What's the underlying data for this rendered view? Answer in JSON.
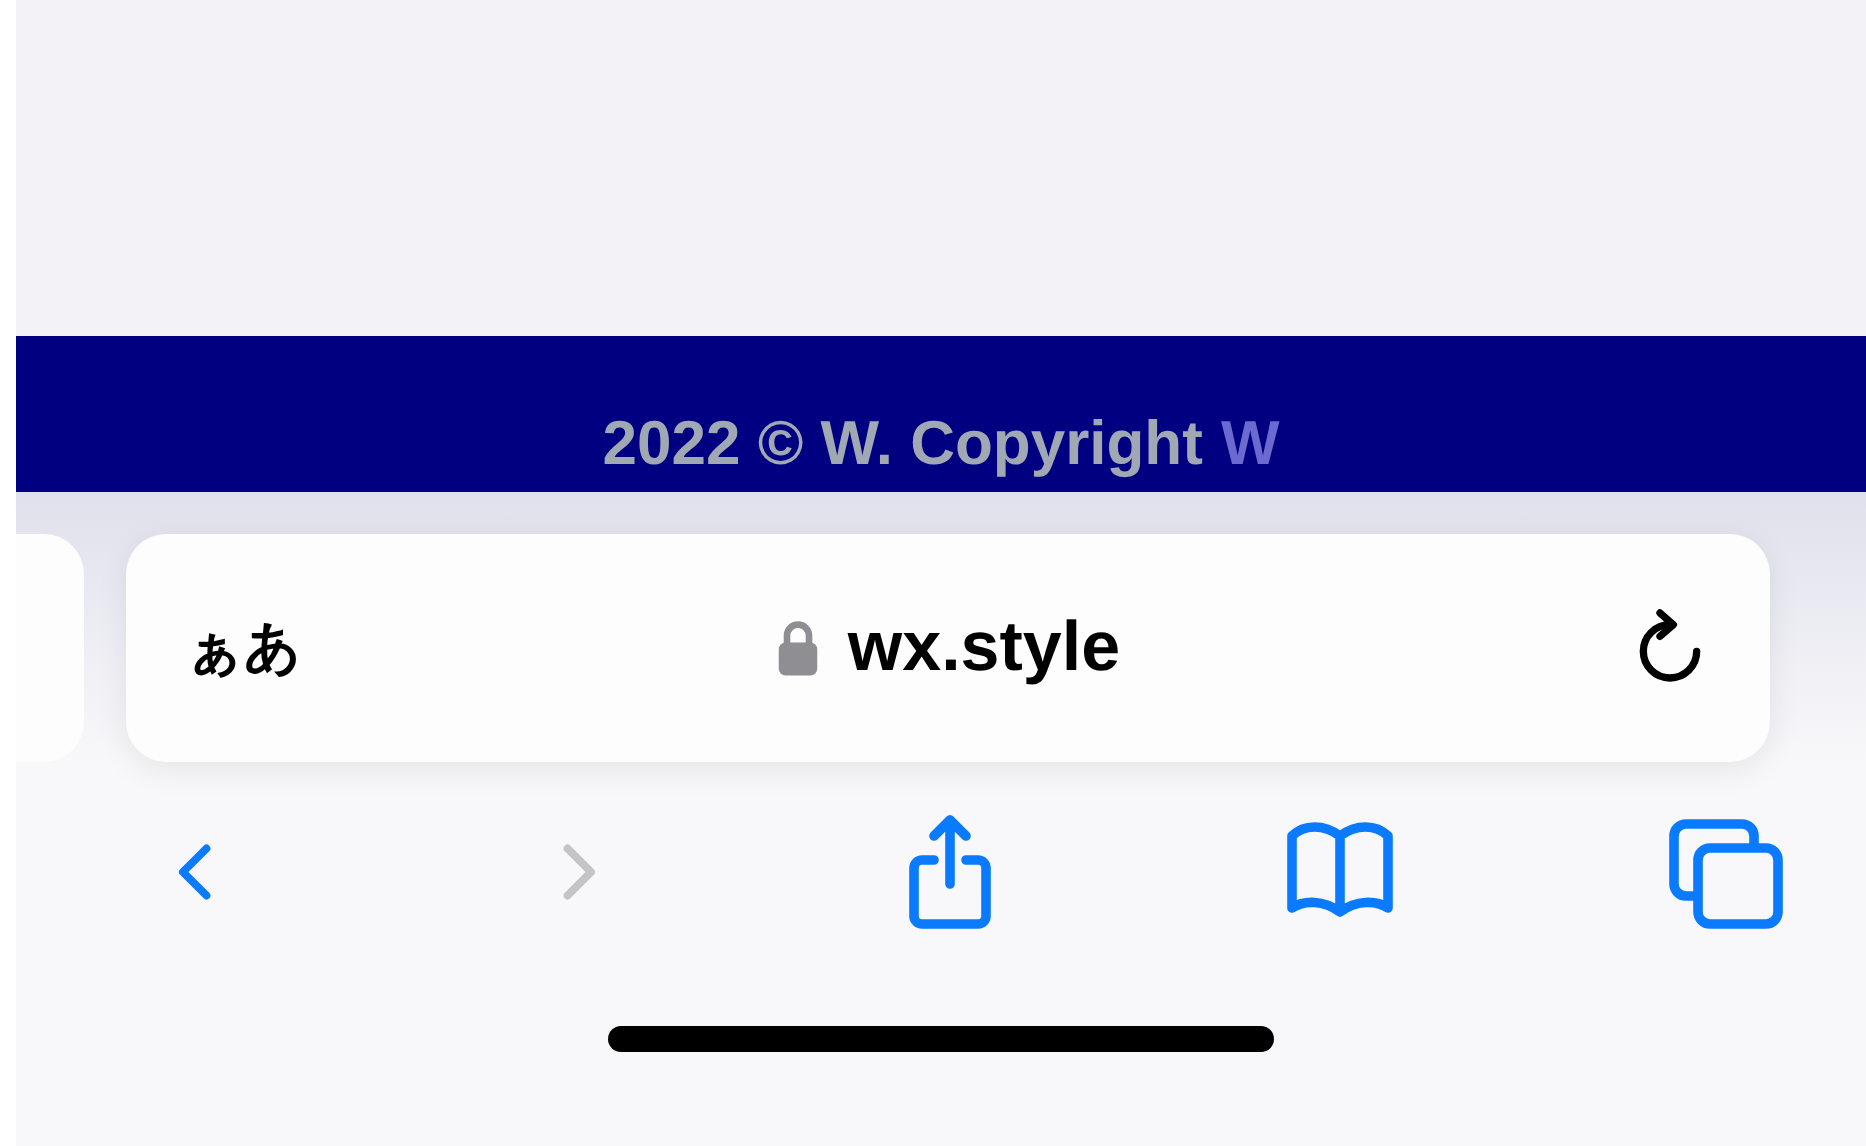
{
  "footer": {
    "text": "2022 © W. Copyright",
    "mark": "W"
  },
  "address_bar": {
    "text_size_button": "ぁあ",
    "secure": true,
    "url": "wx.style"
  },
  "toolbar": [
    {
      "kind": "back",
      "disabled": false
    },
    {
      "kind": "forward",
      "disabled": true
    },
    {
      "kind": "share",
      "disabled": false
    },
    {
      "kind": "bookmarks",
      "disabled": false
    },
    {
      "kind": "tabs",
      "disabled": false
    }
  ]
}
